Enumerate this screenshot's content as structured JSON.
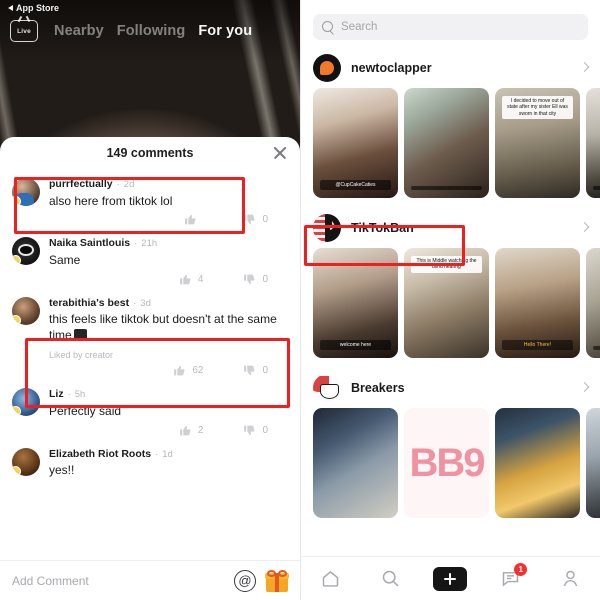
{
  "left": {
    "status_back": "App Store",
    "live_label": "Live",
    "tabs": [
      {
        "label": "Nearby",
        "active": false
      },
      {
        "label": "Following",
        "active": false
      },
      {
        "label": "For you",
        "active": true
      }
    ],
    "sheet": {
      "title": "149 comments",
      "close_icon": "close-icon",
      "comments": [
        {
          "user": "purrfectually",
          "separator": "·",
          "time": "2d",
          "text": "also here from tiktok lol",
          "liked_by_creator": "",
          "likes": "",
          "dislikes": "0"
        },
        {
          "user": "Naika Saintlouis",
          "separator": "·",
          "time": "21h",
          "text": "Same",
          "liked_by_creator": "",
          "likes": "4",
          "dislikes": "0"
        },
        {
          "user": "terabithia's best",
          "separator": "·",
          "time": "3d",
          "text": "this feels like tiktok but doesn't at the same time",
          "liked_by_creator": "Liked by creator",
          "likes": "62",
          "dislikes": "0"
        },
        {
          "user": "Liz",
          "separator": "·",
          "time": "5h",
          "text": "Perfectly said",
          "liked_by_creator": "",
          "likes": "2",
          "dislikes": "0"
        },
        {
          "user": "Elizabeth Riot Roots",
          "separator": "·",
          "time": "1d",
          "text": "yes!!",
          "liked_by_creator": "",
          "likes": "",
          "dislikes": ""
        }
      ],
      "add_comment_placeholder": "Add Comment",
      "mention_icon": "at-mention-icon",
      "gift_icon": "gift-icon"
    }
  },
  "right": {
    "search": {
      "placeholder": "Search",
      "icon": "search-icon"
    },
    "sections": [
      {
        "name": "newtoclapper",
        "avatar": "clapper-logo-avatar",
        "chevron": "chevron-right-icon",
        "tiles": [
          {
            "caption": "@CupCakeCaties",
            "caption_style": "dark"
          },
          {
            "caption": "",
            "caption_style": "dark"
          },
          {
            "caption": "I decided to move out of state after my sister Ell was sworn in that city",
            "caption_style": "light-top"
          },
          {
            "caption": "",
            "caption_style": "dark"
          }
        ]
      },
      {
        "name": "TikTokBan",
        "avatar": "tiktok-logo-avatar",
        "chevron": "chevron-right-icon",
        "tiles": [
          {
            "caption": "welcome here",
            "caption_style": "dark"
          },
          {
            "caption": "This is Middle watching the blind hearing",
            "caption_style": "light-top"
          },
          {
            "caption": "Hello There!",
            "caption_style": "yellow"
          },
          {
            "caption": "",
            "caption_style": "dark"
          }
        ]
      },
      {
        "name": "Breakers",
        "avatar": "breakers-logo-avatar",
        "chevron": "chevron-right-icon",
        "tiles": [
          {
            "caption": "",
            "caption_style": "dark"
          },
          {
            "caption": "BB9",
            "caption_style": "none"
          },
          {
            "caption": "",
            "caption_style": "dark"
          },
          {
            "caption": "",
            "caption_style": "dark"
          }
        ]
      }
    ],
    "nav": [
      {
        "name": "home",
        "icon": "home-icon",
        "badge": ""
      },
      {
        "name": "search",
        "icon": "search-icon",
        "badge": ""
      },
      {
        "name": "create",
        "icon": "plus-icon",
        "badge": ""
      },
      {
        "name": "messages",
        "icon": "chat-bubble-icon",
        "badge": "1"
      },
      {
        "name": "profile",
        "icon": "person-icon",
        "badge": ""
      }
    ]
  },
  "annotations": {
    "color": "#f01f1f",
    "boxes": [
      {
        "id": "anno1",
        "target": "comment-purrfectually"
      },
      {
        "id": "anno2",
        "target": "comment-terabithias-best"
      },
      {
        "id": "anno3",
        "target": "section-header-tiktokban"
      }
    ]
  }
}
